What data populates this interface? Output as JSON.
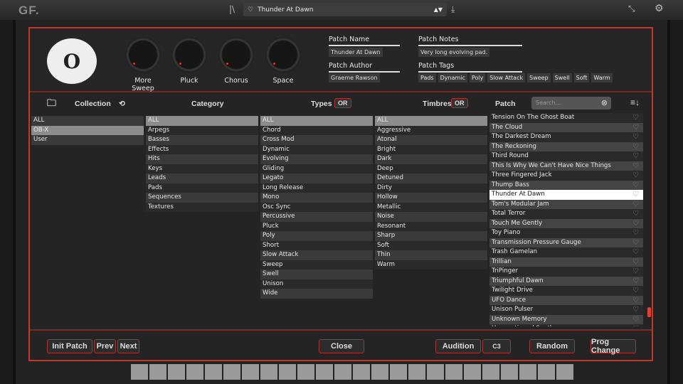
{
  "topbar": {
    "logo": "GF.",
    "preset_name": "Thunder At Dawn"
  },
  "knobs": [
    "More Sweep",
    "Pluck",
    "Chorus",
    "Space"
  ],
  "patch_name": {
    "label": "Patch Name",
    "value": "Thunder At Dawn"
  },
  "patch_notes": {
    "label": "Patch Notes",
    "value": "Very long evolving pad."
  },
  "patch_author": {
    "label": "Patch Author",
    "value": "Graeme Rawson"
  },
  "patch_tags": {
    "label": "Patch Tags",
    "values": [
      "Pads",
      "Dynamic",
      "Poly",
      "Slow Attack",
      "Sweep",
      "Swell",
      "Soft",
      "Warm"
    ]
  },
  "columns": {
    "collection": "Collection",
    "category": "Category",
    "types": "Types",
    "types_mode": "OR",
    "timbres": "Timbres",
    "timbres_mode": "OR",
    "patch": "Patch",
    "search_placeholder": "Search..."
  },
  "collection": {
    "items": [
      "ALL",
      "OB-X",
      "User"
    ],
    "selected": "OB-X"
  },
  "category": {
    "items": [
      "ALL",
      "Arpegs",
      "Basses",
      "Effects",
      "Hits",
      "Keys",
      "Leads",
      "Pads",
      "Sequences",
      "Textures"
    ],
    "selected": "ALL"
  },
  "types": {
    "items": [
      "ALL",
      "Chord",
      "Cross Mod",
      "Dynamic",
      "Evolving",
      "Gliding",
      "Legato",
      "Long Release",
      "Mono",
      "Osc Sync",
      "Percussive",
      "Pluck",
      "Poly",
      "Short",
      "Slow Attack",
      "Sweep",
      "Swell",
      "Unison",
      "Wide"
    ],
    "selected": "ALL"
  },
  "timbres": {
    "items": [
      "ALL",
      "Aggressive",
      "Atonal",
      "Bright",
      "Dark",
      "Deep",
      "Detuned",
      "Dirty",
      "Hollow",
      "Metallic",
      "Noise",
      "Resonant",
      "Sharp",
      "Soft",
      "Thin",
      "Warm"
    ],
    "selected": "ALL"
  },
  "patches": {
    "items": [
      "Tension On The Ghost Boat",
      "The Cloud",
      "The Darkest Dream",
      "The Reckoning",
      "Third Round",
      "This Is Why We Can't Have Nice Things",
      "Three Fingered Jack",
      "Thump Bass",
      "Thunder At Dawn",
      "Tom's Modular Jam",
      "Total Terror",
      "Touch Me Gently",
      "Toy Piano",
      "Transmission Pressure Gauge",
      "Trash Gamelan",
      "Trillian",
      "TriPinger",
      "Triumphful Dawn",
      "Twilight Drive",
      "UFO Dance",
      "Unison Pulser",
      "Unknown Memory",
      "Unquestioned Synth"
    ],
    "current": "Thunder At Dawn"
  },
  "footer": {
    "init": "Init Patch",
    "prev": "Prev",
    "next": "Next",
    "close": "Close",
    "audition": "Audition",
    "note": "C3",
    "random": "Random",
    "prog_change": "Prog Change"
  },
  "colors": {
    "accent": "#c0392b"
  }
}
